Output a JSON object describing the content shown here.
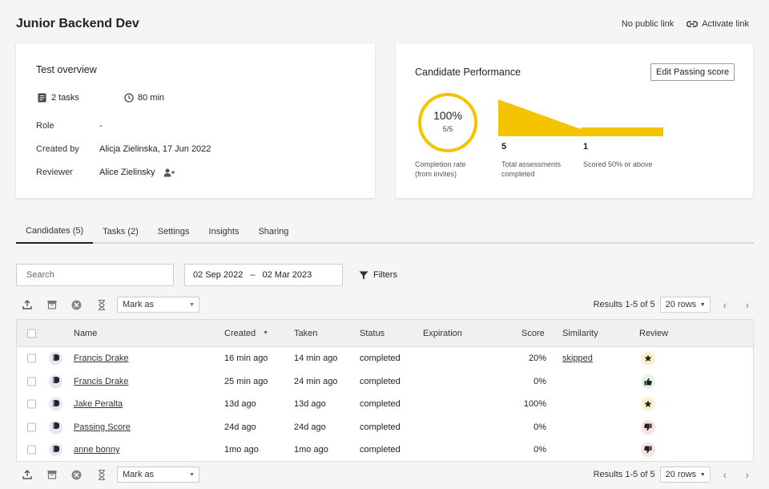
{
  "header": {
    "title": "Junior Backend Dev",
    "public_link_status": "No public link",
    "activate_link_label": "Activate link"
  },
  "overview": {
    "heading": "Test overview",
    "tasks": "2 tasks",
    "duration": "80 min",
    "role_label": "Role",
    "role_value": "-",
    "created_label": "Created by",
    "created_value": "Alicja Zielinska, 17 Jun 2022",
    "reviewer_label": "Reviewer",
    "reviewer_value": "Alice Zielinsky"
  },
  "performance": {
    "heading": "Candidate Performance",
    "edit_button": "Edit Passing score",
    "completion_pct": "100%",
    "completion_frac": "5/5",
    "completion_value": 1.0,
    "completion_label_1": "Completion rate",
    "completion_label_2": "(from invites)",
    "total_num": "5",
    "total_label_1": "Total assessments",
    "total_label_2": "completed",
    "scored_num": "1",
    "scored_label": "Scored 50% or above",
    "accent_color": "#f5c400"
  },
  "tabs": [
    "Candidates (5)",
    "Tasks (2)",
    "Settings",
    "Insights",
    "Sharing"
  ],
  "filters": {
    "search_placeholder": "Search",
    "date_from": "02 Sep 2022",
    "date_sep": "–",
    "date_to": "02 Mar 2023",
    "filters_label": "Filters"
  },
  "toolbar": {
    "mark_as": "Mark as",
    "results": "Results 1-5 of 5",
    "rows": "20 rows"
  },
  "table": {
    "headers": {
      "name": "Name",
      "created": "Created",
      "taken": "Taken",
      "status": "Status",
      "expiration": "Expiration",
      "score": "Score",
      "similarity": "Similarity",
      "review": "Review"
    },
    "rows": [
      {
        "name": "Francis Drake",
        "created": "16 min ago",
        "taken": "14 min ago",
        "status": "completed",
        "score": "20%",
        "similarity": "skipped",
        "review": "star-icon"
      },
      {
        "name": "Francis Drake",
        "created": "25 min ago",
        "taken": "24 min ago",
        "status": "completed",
        "score": "0%",
        "similarity": "",
        "review": "thumbs-up-icon"
      },
      {
        "name": "Jake Peralta",
        "created": "13d ago",
        "taken": "13d ago",
        "status": "completed",
        "score": "100%",
        "similarity": "",
        "review": "star-icon"
      },
      {
        "name": "Passing Score",
        "created": "24d ago",
        "taken": "24d ago",
        "status": "completed",
        "score": "0%",
        "similarity": "",
        "review": "thumbs-down-icon"
      },
      {
        "name": "anne bonny",
        "created": "1mo ago",
        "taken": "1mo ago",
        "status": "completed",
        "score": "0%",
        "similarity": "",
        "review": "thumbs-down-icon"
      }
    ]
  }
}
